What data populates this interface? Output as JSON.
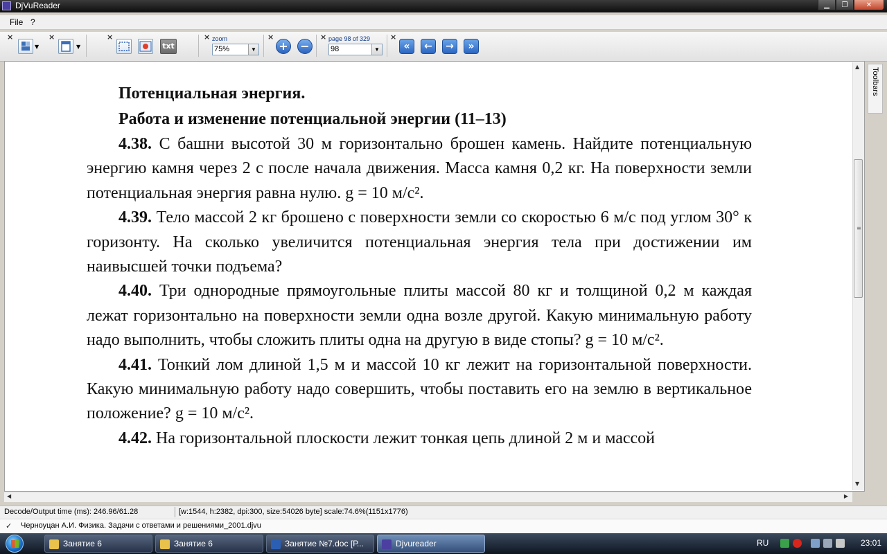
{
  "window": {
    "title": "DjVuReader"
  },
  "menu": {
    "file": "File",
    "help": "?"
  },
  "toolbar": {
    "zoom_label": "zoom",
    "zoom_value": "75%",
    "page_label": "page 98 of 329",
    "page_value": "98",
    "text_button": "txt",
    "close_glyph": "×"
  },
  "sidebar": {
    "toolbars_label": "Toolbars"
  },
  "document": {
    "heading1": "Потенциальная энергия.",
    "heading2": "Работа и изменение потенциальной энергии (11–13)",
    "problems": [
      {
        "num": "4.38.",
        "text": "С башни высотой 30 м горизонтально брошен камень. Найдите потенциальную энергию камня через 2 с после начала движения. Масса камня 0,2 кг. На поверхности земли потенциальная энергия равна нулю. g = 10 м/с²."
      },
      {
        "num": "4.39.",
        "text": "Тело массой 2 кг брошено с поверхности земли со скоростью 6 м/с под углом 30° к горизонту. На сколько увеличится потенциальная энергия тела при достижении им наивысшей точки подъема?"
      },
      {
        "num": "4.40.",
        "text": "Три однородные прямоугольные плиты массой 80 кг и толщиной 0,2 м каждая лежат горизонтально на поверхности земли одна возле другой. Какую минимальную работу надо выполнить, чтобы сложить плиты одна на другую в виде стопы? g = 10 м/с²."
      },
      {
        "num": "4.41.",
        "text": "Тонкий лом длиной 1,5 м и массой 10 кг лежит на горизонтальной поверхности. Какую минимальную работу надо совершить, чтобы поставить его на землю в вертикальное положение? g = 10 м/с²."
      },
      {
        "num": "4.42.",
        "text": "На горизонтальной плоскости лежит тонкая цепь длиной 2 м и массой"
      }
    ]
  },
  "status": {
    "decode": "Decode/Output time (ms): 246.96/61.28",
    "info": "[w:1544, h:2382, dpi:300, size:54026 byte] scale:74.6%(1151x1776)"
  },
  "file": {
    "name": "Черноуцан А.И. Физика. Задачи с ответами и решениями_2001.djvu"
  },
  "taskbar": {
    "items": [
      {
        "label": "Занятие 6",
        "color": "#e8c24a"
      },
      {
        "label": "Занятие 6",
        "color": "#e8c24a"
      },
      {
        "label": "Занятие №7.doc [Р...",
        "color": "#2b5fb4"
      },
      {
        "label": "Djvureader",
        "color": "#4b3fa1"
      }
    ],
    "lang": "RU",
    "clock": "23:01"
  }
}
